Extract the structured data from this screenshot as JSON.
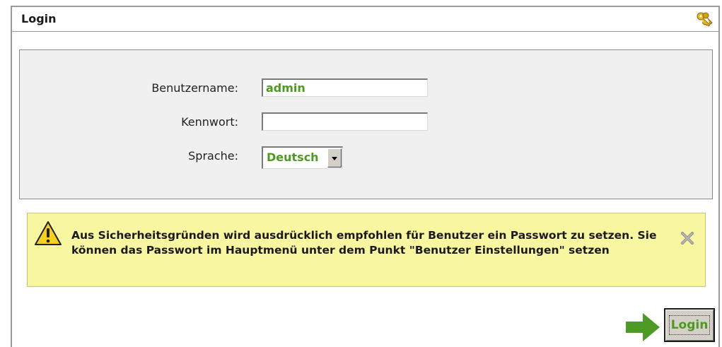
{
  "panel": {
    "title": "Login",
    "header_icon": "keys-icon"
  },
  "form": {
    "username_label": "Benutzername:",
    "username_value": "admin",
    "password_label": "Kennwort:",
    "password_value": "",
    "language_label": "Sprache:",
    "language_value": "Deutsch"
  },
  "warning": {
    "icon": "warning-icon",
    "text": "Aus Sicherheitsgründen wird ausdrücklich empfohlen für Benutzer ein Passwort zu setzen. Sie können das Passwort im Hauptmenü unter dem Punkt \"Benutzer Einstellungen\" setzen",
    "close_icon": "close-icon"
  },
  "actions": {
    "arrow_icon": "arrow-right-icon",
    "login_label": "Login"
  },
  "colors": {
    "value_text": "#4c9a1f",
    "warning_bg": "#f8f6a0",
    "arrow": "#4e9a26"
  }
}
